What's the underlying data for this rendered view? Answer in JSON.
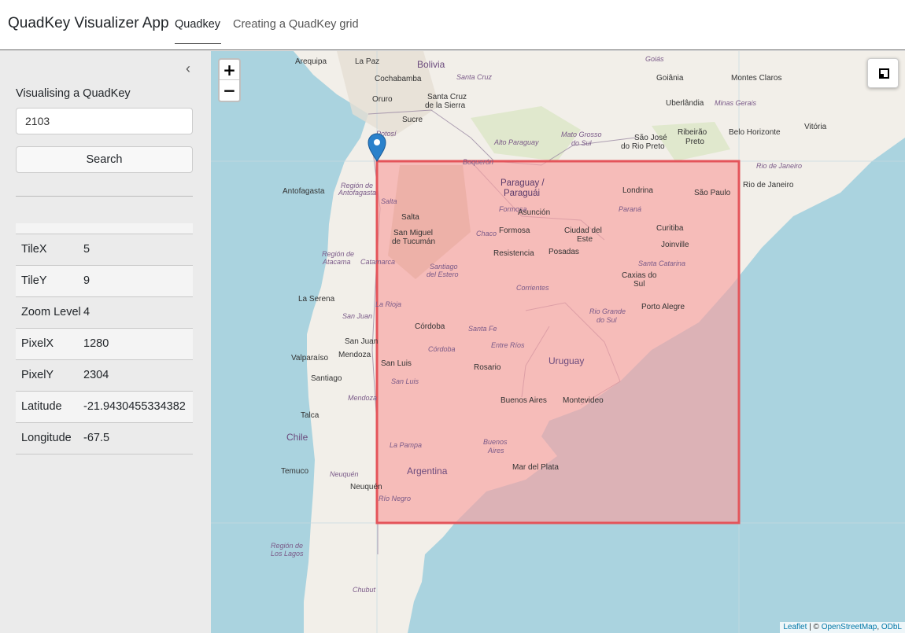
{
  "app": {
    "title": "QuadKey Visualizer App",
    "tabs": [
      {
        "label": "Quadkey",
        "active": true
      },
      {
        "label": "Creating a QuadKey grid",
        "active": false
      }
    ]
  },
  "sidebar": {
    "collapse_glyph": "‹",
    "section_label": "Visualising a QuadKey",
    "input_value": "2103",
    "search_label": "Search",
    "properties": [
      {
        "key": "TileX",
        "value": "5"
      },
      {
        "key": "TileY",
        "value": "9"
      },
      {
        "key": "Zoom Level",
        "value": "4"
      },
      {
        "key": "PixelX",
        "value": "1280"
      },
      {
        "key": "PixelY",
        "value": "2304"
      },
      {
        "key": "Latitude",
        "value": "-21.9430455334382"
      },
      {
        "key": "Longitude",
        "value": "-67.5"
      }
    ]
  },
  "map": {
    "zoom_in": "+",
    "zoom_out": "−",
    "attribution": {
      "leaflet": "Leaflet",
      "separator": "| ©",
      "osm": "OpenStreetMap",
      "odbl": "ODbL"
    },
    "colors": {
      "water": "#aad3df",
      "land": "#f2efe9",
      "highlight_fill": "#f7a0a0",
      "highlight_stroke": "#e4545a",
      "marker": "#2a81cb"
    },
    "labels": {
      "countries": [
        "Bolivia",
        "Paraguay /",
        "Paraguái",
        "Argentina",
        "Chile",
        "Uruguay"
      ],
      "cities": [
        "Arequipa",
        "La Paz",
        "Cochabamba",
        "Oruro",
        "Santa Cruz",
        "Santa Cruz",
        "de la Sierra",
        "Sucre",
        "Potosí",
        "Goiás",
        "Goiânia",
        "Montes Claros",
        "Uberlândia",
        "Minas Gerais",
        "Vitória",
        "Mato Grosso",
        "do Sul",
        "Alto Paraguay",
        "Boquerón",
        "São José",
        "do Rio Preto",
        "Ribeirão",
        "Preto",
        "Belo Horizonte",
        "São Paulo",
        "Rio de Janeiro",
        "Rio de Janeiro",
        "Londrina",
        "Antofagasta",
        "Región de",
        "Antofagasta",
        "Salta",
        "Salta",
        "Formosa",
        "Asunción",
        "Formosa",
        "Ciudad del",
        "Este",
        "Paraná",
        "Curitiba",
        "Joinville",
        "San Miguel",
        "de Tucumán",
        "Chaco",
        "Resistencia",
        "Posadas",
        "Santa Catarina",
        "Santiago",
        "del Estero",
        "Caxias do",
        "Sul",
        "Región de",
        "Atacama",
        "Catamarca",
        "Corrientes",
        "Porto Alegre",
        "La Serena",
        "La Rioja",
        "Rio Grande",
        "do Sul",
        "San Juan",
        "Córdoba",
        "Santa Fe",
        "San Juan",
        "Entre Ríos",
        "Valparaíso",
        "Mendoza",
        "Córdoba",
        "Uruguay",
        "Santiago",
        "San Luis",
        "Rosario",
        "San Luis",
        "Mendoza",
        "Buenos Aires",
        "Montevideo",
        "Talca",
        "Chile",
        "La Pampa",
        "Buenos",
        "Aires",
        "Mar del Plata",
        "Temuco",
        "Neuquén",
        "Argentina",
        "Neuquén",
        "Río Negro",
        "Región de",
        "Los Lagos",
        "Chubut"
      ]
    }
  }
}
